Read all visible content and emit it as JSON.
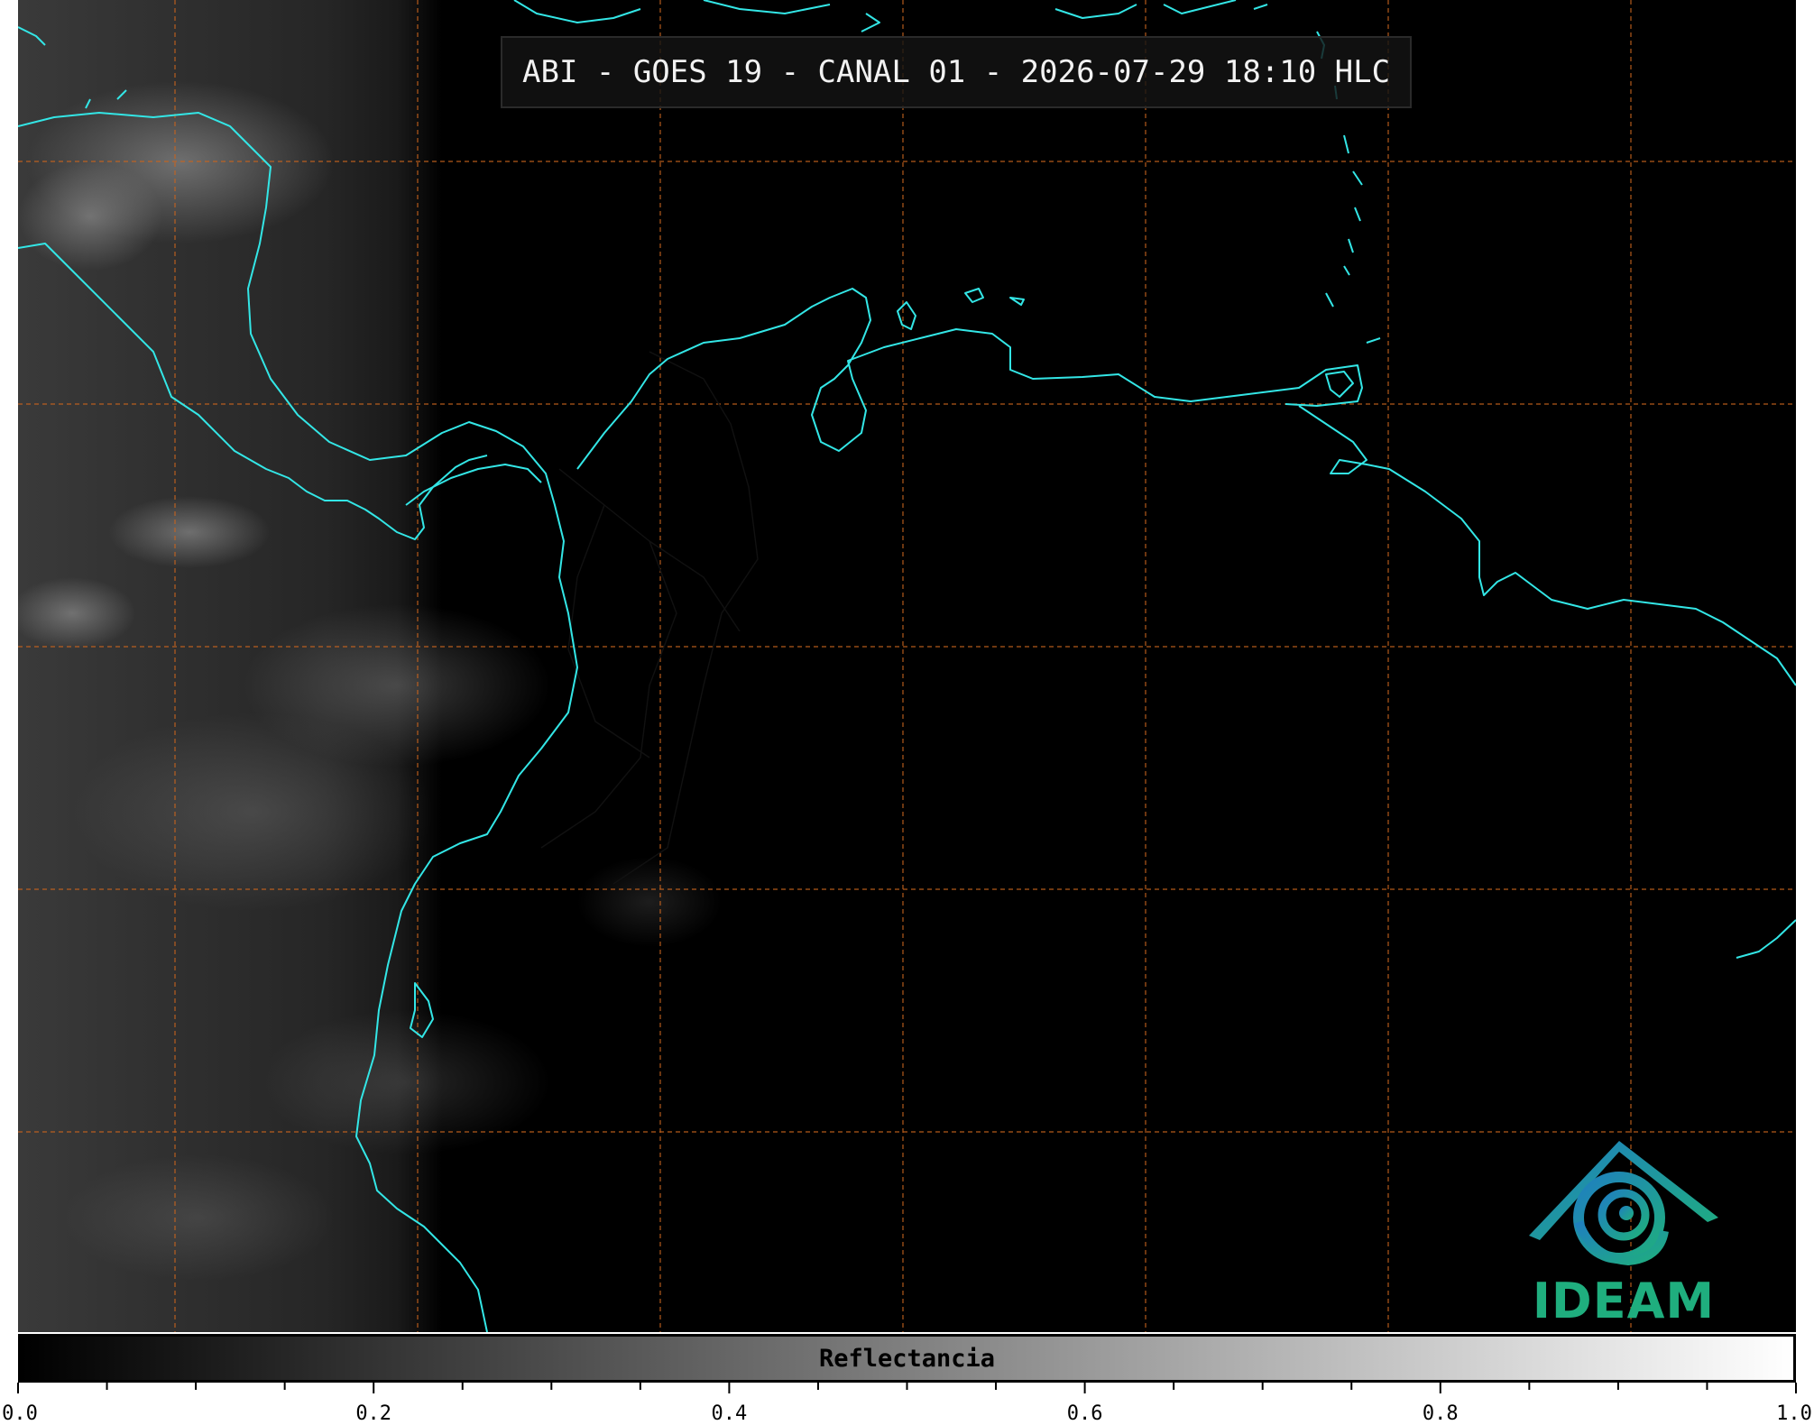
{
  "title": "ABI - GOES 19 - CANAL 01 - 2026-07-29 18:10 HLC",
  "colorbar": {
    "label": "Reflectancia",
    "min": 0.0,
    "max": 1.0,
    "tick_labels": [
      "0.0",
      "0.2",
      "0.4",
      "0.6",
      "0.8",
      "1.0"
    ]
  },
  "logo": {
    "text": "IDEAM"
  },
  "colors": {
    "coastline": "#33e6e6",
    "grid": "#c8641e",
    "logo_green": "#1fae7e",
    "logo_blue": "#1f7fc0"
  }
}
